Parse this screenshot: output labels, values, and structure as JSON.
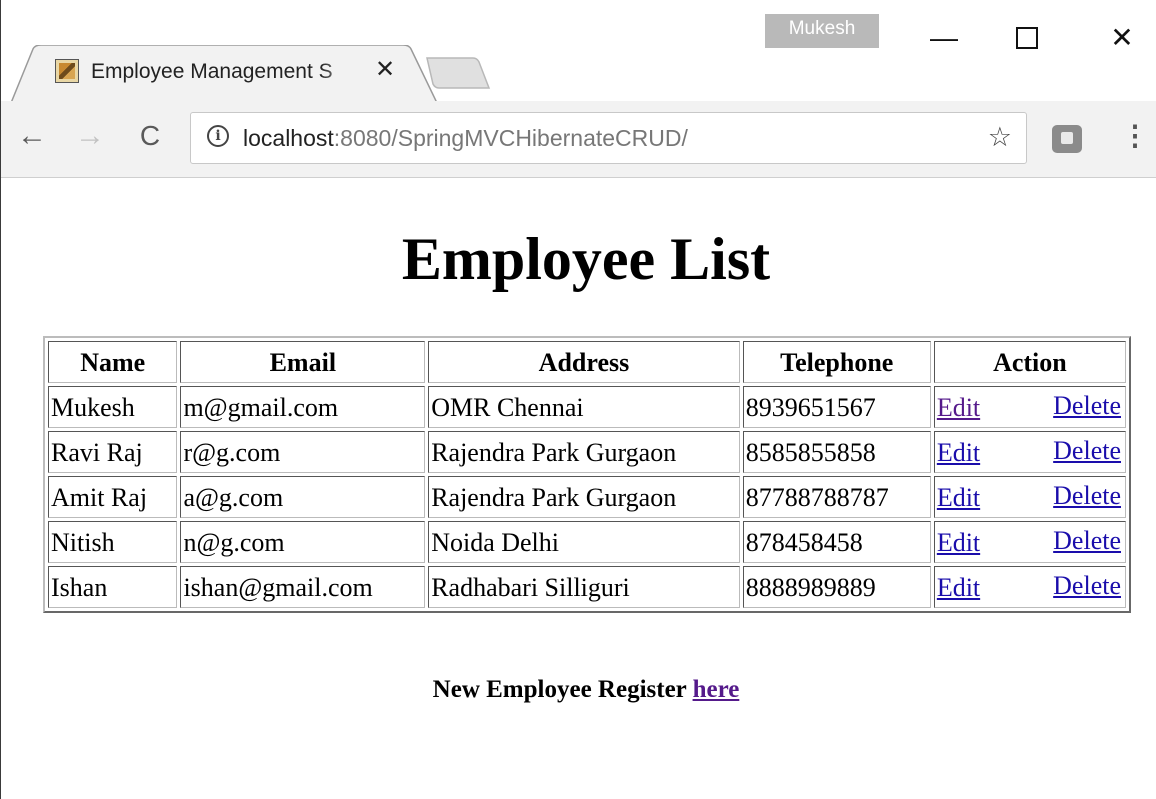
{
  "window": {
    "profile_name": "Mukesh",
    "minimize_glyph": "—",
    "close_glyph": "✕"
  },
  "tab": {
    "title": "Employee Management S",
    "close_glyph": "✕",
    "favicon": "spring-leaf-favicon"
  },
  "toolbar": {
    "back_glyph": "←",
    "forward_glyph": "→",
    "reload_glyph": "C",
    "info_glyph": "i",
    "url_host": "localhost",
    "url_rest": ":8080/SpringMVCHibernateCRUD/",
    "star_glyph": "☆",
    "menu_glyph": "⋮"
  },
  "page": {
    "title": "Employee List",
    "columns": [
      "Name",
      "Email",
      "Address",
      "Telephone",
      "Action"
    ],
    "rows": [
      {
        "name": "Mukesh",
        "email": "m@gmail.com",
        "address": "OMR Chennai",
        "telephone": "8939651567",
        "edit": "Edit",
        "delete": "Delete"
      },
      {
        "name": "Ravi Raj",
        "email": "r@g.com",
        "address": "Rajendra Park Gurgaon",
        "telephone": "8585855858",
        "edit": "Edit",
        "delete": "Delete"
      },
      {
        "name": "Amit Raj",
        "email": "a@g.com",
        "address": "Rajendra Park Gurgaon",
        "telephone": "87788788787",
        "edit": "Edit",
        "delete": "Delete"
      },
      {
        "name": "Nitish",
        "email": "n@g.com",
        "address": "Noida Delhi",
        "telephone": "878458458",
        "edit": "Edit",
        "delete": "Delete"
      },
      {
        "name": "Ishan",
        "email": "ishan@gmail.com",
        "address": "Radhabari Silliguri",
        "telephone": "8888989889",
        "edit": "Edit",
        "delete": "Delete"
      }
    ],
    "register_text": "New Employee Register",
    "register_link": "here"
  },
  "colors": {
    "link": "#1a0dab",
    "visited_link": "#551a8b",
    "toolbar_bg": "#f2f2f2",
    "profile_bg": "#b9b9b9"
  }
}
